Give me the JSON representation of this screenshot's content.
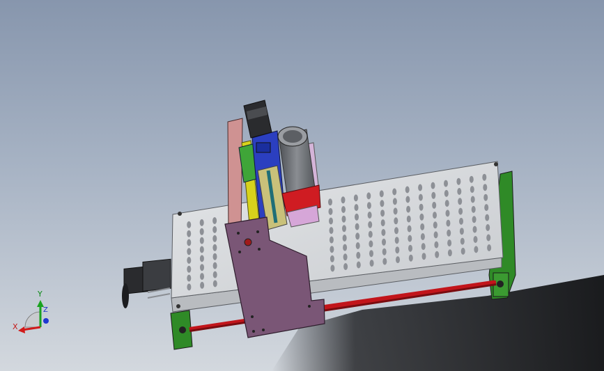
{
  "triad": {
    "x_label": "X",
    "y_label": "Y",
    "z_label": "Z",
    "colors": {
      "x": "#d11a1a",
      "y": "#19a21f",
      "z": "#1f37d1"
    }
  },
  "model": {
    "colors": {
      "table_top": "#d9dbdd",
      "table_edge": "#b9bcc0",
      "slot": "#8d9096",
      "frame_green": "#2f8a27",
      "rail_red": "#c2151b",
      "gantry_plate": "#7a5676",
      "pink_plate": "#cf9292",
      "carriage_blue": "#2b3fc0",
      "spindle_gray": "#6a6d72",
      "spindle_red": "#cf1c22",
      "yellow_rail": "#d7d21c",
      "motor_black": "#2a2b2e"
    }
  }
}
